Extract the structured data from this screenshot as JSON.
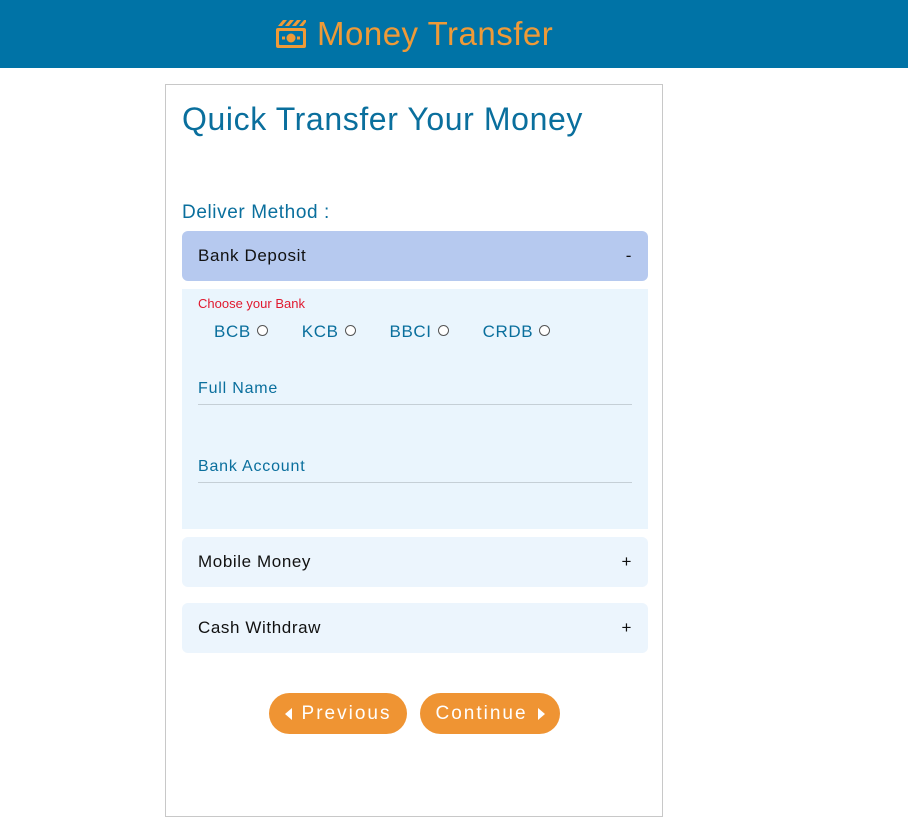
{
  "header": {
    "brand_title": "Money Transfer",
    "brand_icon": "money-icon"
  },
  "form": {
    "heading": "Quick Transfer Your Money",
    "deliver_method_label": "Deliver Method :",
    "sections": [
      {
        "label": "Bank Deposit",
        "toggle": "-",
        "expanded": true
      },
      {
        "label": "Mobile Money",
        "toggle": "+",
        "expanded": false
      },
      {
        "label": "Cash Withdraw",
        "toggle": "+",
        "expanded": false
      }
    ],
    "bank_deposit": {
      "choose_label": "Choose your Bank",
      "banks": [
        "BCB",
        "KCB",
        "BBCI",
        "CRDB"
      ],
      "full_name_placeholder": "Full Name",
      "bank_account_placeholder": "Bank Account"
    },
    "buttons": {
      "previous": "Previous",
      "continue": "Continue"
    }
  },
  "colors": {
    "topbar": "#0073a6",
    "brand": "#ef9a37",
    "accent_text": "#0a6f9d",
    "open_section": "#b6c9ef",
    "panel": "#eaf5fd",
    "button": "#ef9433",
    "error_text": "#e0192f"
  }
}
